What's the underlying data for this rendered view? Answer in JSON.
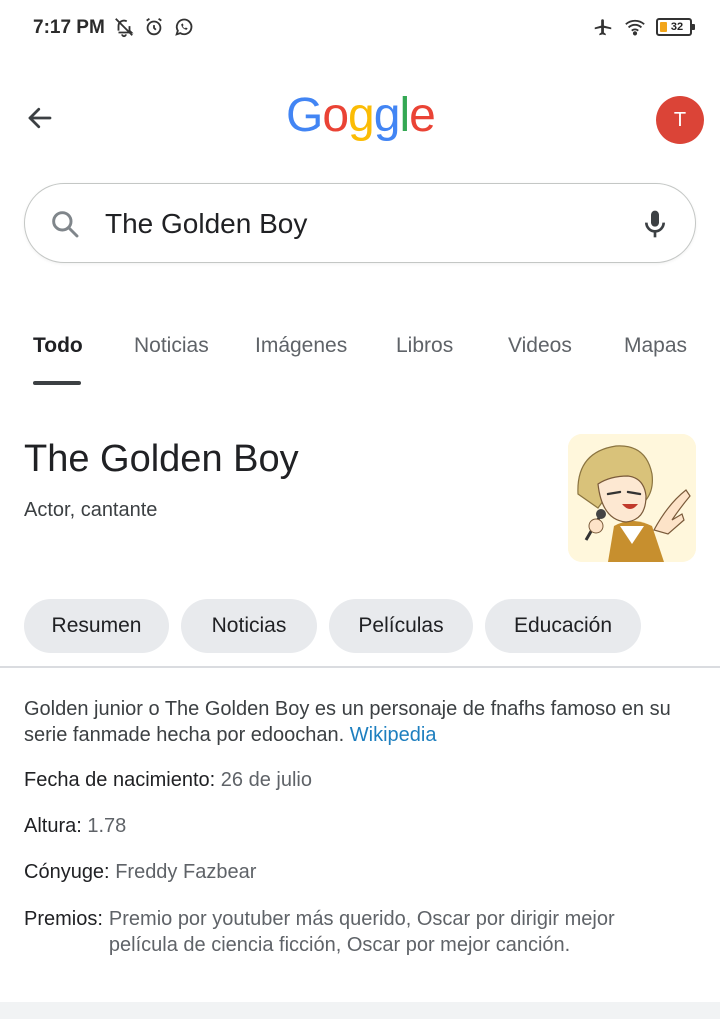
{
  "status_bar": {
    "time": "7:17 PM",
    "battery": "32",
    "icons_left": [
      "bell-off-icon",
      "alarm-icon",
      "whatsapp-icon"
    ],
    "icons_right": [
      "airplane-icon",
      "wifi-icon",
      "battery-icon"
    ]
  },
  "header": {
    "logo_letters": [
      {
        "char": "G",
        "color": "#4285F4"
      },
      {
        "char": "o",
        "color": "#EA4335"
      },
      {
        "char": "g",
        "color": "#FBBC05"
      },
      {
        "char": "g",
        "color": "#4285F4"
      },
      {
        "char": "l",
        "color": "#34A853"
      },
      {
        "char": "e",
        "color": "#EA4335"
      }
    ],
    "avatar_initial": "T",
    "avatar_color": "#DB4437"
  },
  "search": {
    "query": "The Golden Boy"
  },
  "tabs": [
    {
      "label": "Todo",
      "active": true
    },
    {
      "label": "Noticias",
      "active": false
    },
    {
      "label": "Imágenes",
      "active": false
    },
    {
      "label": "Libros",
      "active": false
    },
    {
      "label": "Videos",
      "active": false
    },
    {
      "label": "Mapas",
      "active": false
    }
  ],
  "knowledge_panel": {
    "title": "The Golden Boy",
    "subtitle": "Actor, cantante",
    "chips": [
      "Resumen",
      "Noticias",
      "Películas",
      "Educación"
    ],
    "description": "Golden junior o The Golden Boy es un personaje de fnafhs famoso en su serie fanmade hecha por edoochan.",
    "source_link": "Wikipedia",
    "facts": [
      {
        "label": "Fecha de nacimiento:",
        "value": "26 de julio"
      },
      {
        "label": "Altura:",
        "value": "1.78"
      },
      {
        "label": "Cónyuge:",
        "value": "Freddy Fazbear"
      },
      {
        "label": "Premios:",
        "value": "Premio por youtuber más querido, Oscar por dirigir mejor película de ciencia ficción, Oscar por mejor canción."
      }
    ]
  }
}
